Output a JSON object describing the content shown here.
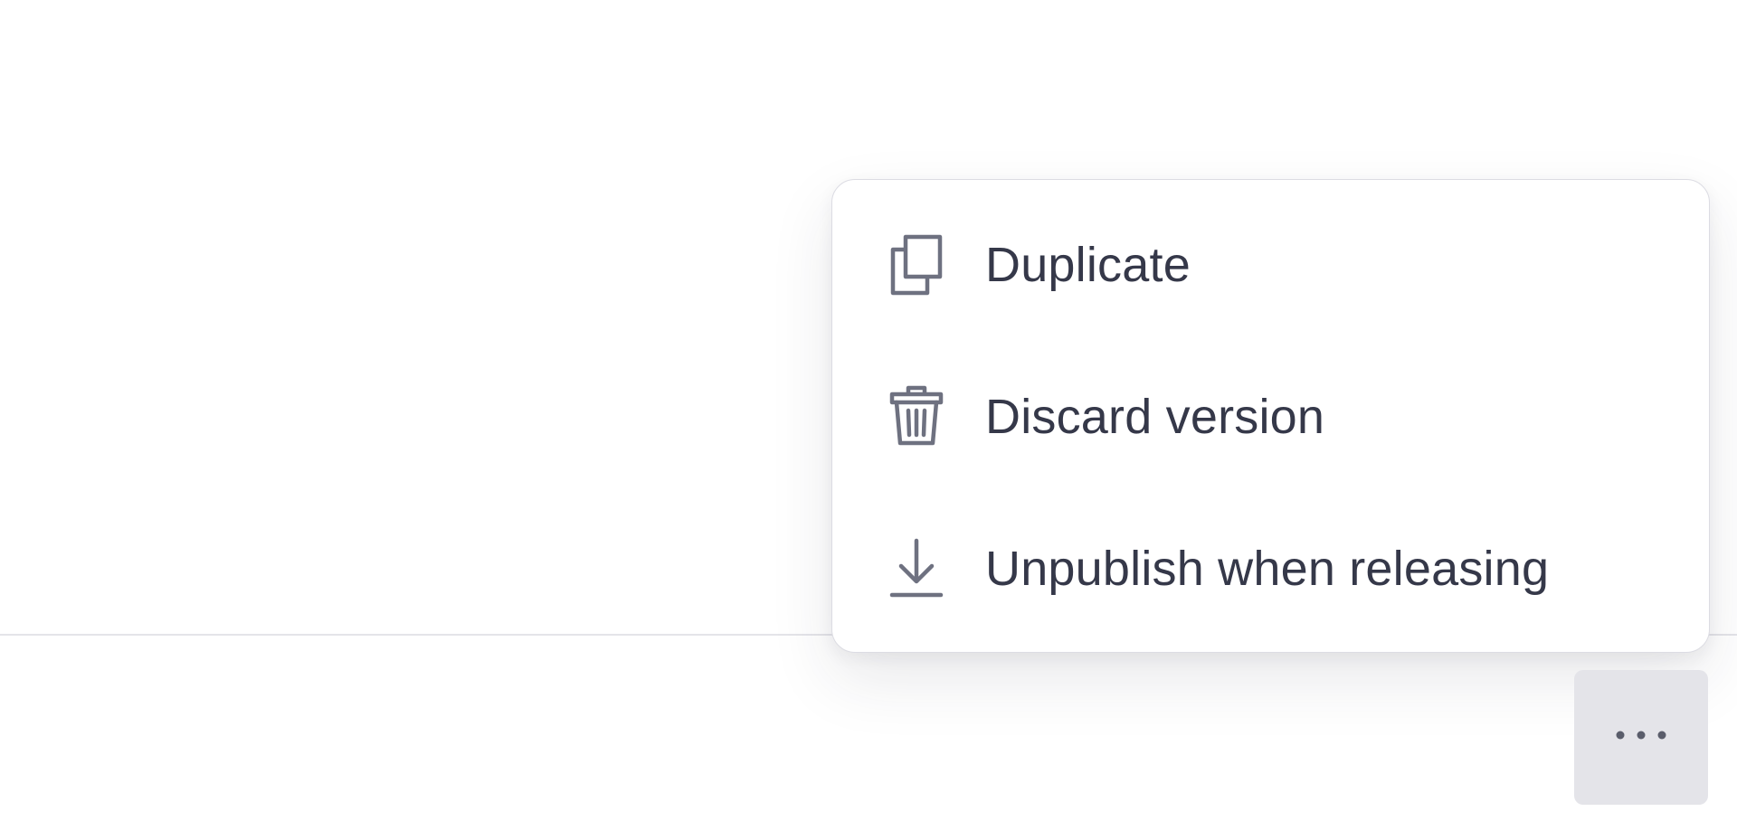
{
  "menu": {
    "items": [
      {
        "label": "Duplicate",
        "icon": "duplicate-icon"
      },
      {
        "label": "Discard version",
        "icon": "trash-icon"
      },
      {
        "label": "Unpublish when releasing",
        "icon": "download-icon"
      }
    ]
  },
  "toolbar": {
    "more_icon": "ellipsis-icon"
  },
  "colors": {
    "text": "#353849",
    "icon": "#6e7180",
    "button_bg": "#e4e4e9",
    "divider": "#e4e4e9",
    "menu_border": "#dcdce3"
  }
}
